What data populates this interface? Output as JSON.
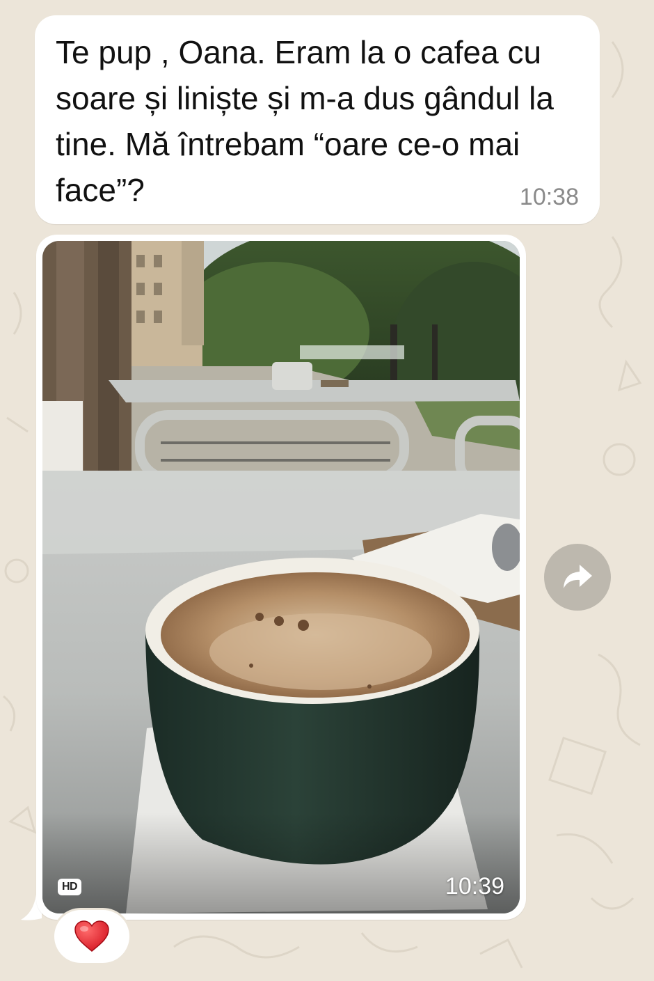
{
  "chat": {
    "messages": [
      {
        "type": "text",
        "text": "Te pup , Oana. Eram la o cafea cu soare și liniște și m-a dus gândul la tine. Mă întrebam “oare ce-o mai face”?",
        "time": "10:38"
      },
      {
        "type": "photo",
        "badge": "HD",
        "time": "10:39",
        "subject": "cup of coffee on a cafe table",
        "reaction": "❤️"
      }
    ]
  },
  "icons": {
    "forward": "forward-arrow-icon",
    "heart": "heart-icon"
  },
  "colors": {
    "wallpaper": "#ece5d9",
    "bubble": "#ffffff",
    "forward_button": "#bdb8ae",
    "timestamp": "#8a8a8a"
  }
}
